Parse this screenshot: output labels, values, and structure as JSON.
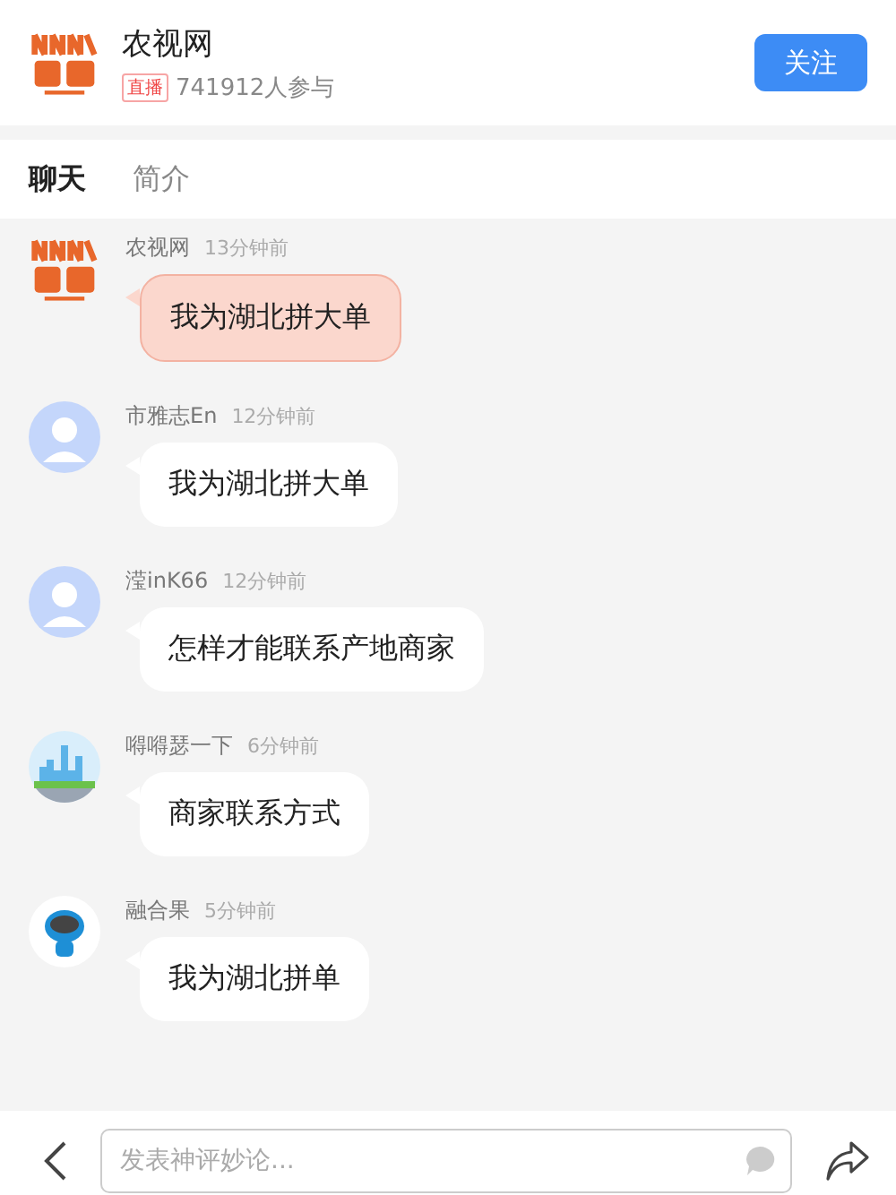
{
  "header": {
    "channel_name": "农视网",
    "live_badge": "直播",
    "participants": "741912人参与",
    "follow_button": "关注"
  },
  "tabs": [
    {
      "label": "聊天",
      "selected": true
    },
    {
      "label": "简介",
      "selected": false
    }
  ],
  "messages": [
    {
      "kind": "host",
      "avatar": {
        "kind": "logo"
      },
      "user": "农视网",
      "time": "13分钟前",
      "text": "我为湖北拼大单"
    },
    {
      "kind": "user",
      "avatar": {
        "kind": "default"
      },
      "user": "市雅志En",
      "time": "12分钟前",
      "text": "我为湖北拼大单"
    },
    {
      "kind": "user",
      "avatar": {
        "kind": "default"
      },
      "user": "滢inK66",
      "time": "12分钟前",
      "text": "怎样才能联系产地商家"
    },
    {
      "kind": "user",
      "avatar": {
        "kind": "city"
      },
      "user": "嘚嘚瑟一下",
      "time": "6分钟前",
      "text": "商家联系方式"
    },
    {
      "kind": "user",
      "avatar": {
        "kind": "robot"
      },
      "user": "融合果",
      "time": "5分钟前",
      "text": "我为湖北拼单"
    }
  ],
  "comment_bar": {
    "placeholder": "发表神评妙论..."
  }
}
